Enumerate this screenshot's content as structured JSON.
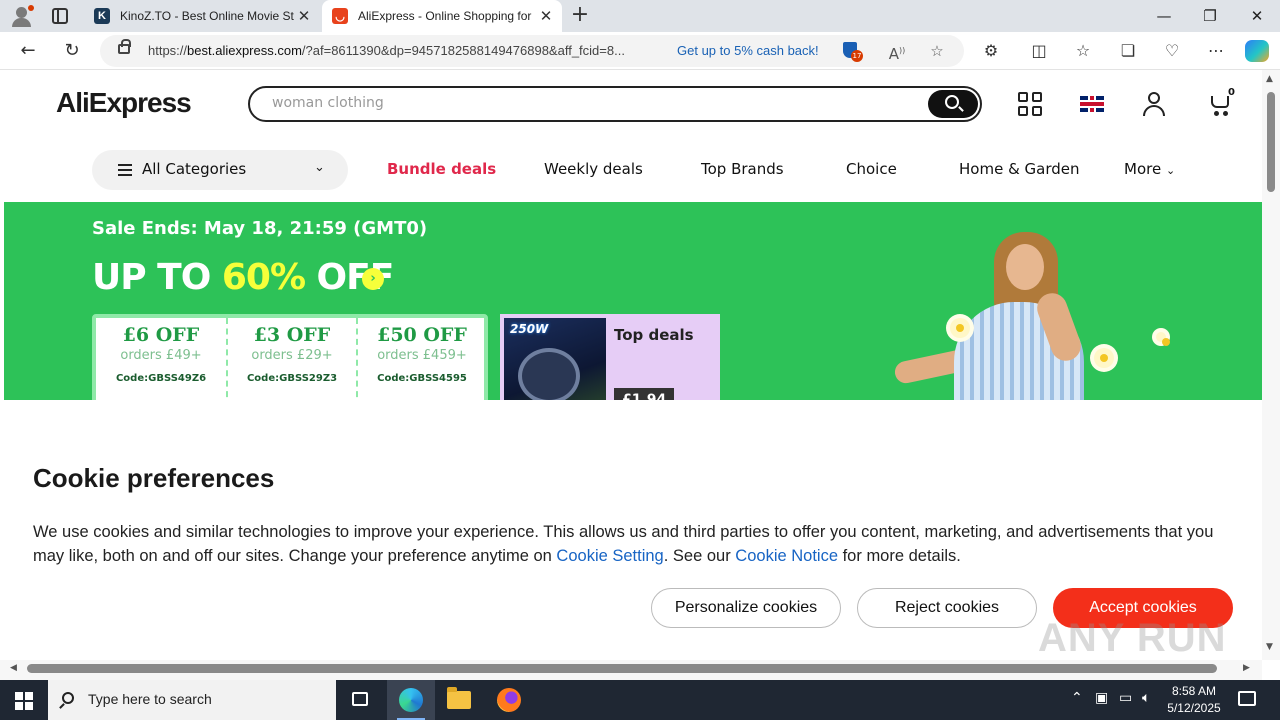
{
  "browser": {
    "tabs": [
      {
        "title": "KinoZ.TO - Best Online Movie Str",
        "favicon": "K"
      },
      {
        "title": "AliExpress - Online Shopping for",
        "favicon": "ali-bag"
      }
    ],
    "url_prefix": "https://",
    "url_host": "best.aliexpress.com",
    "url_rest": "/?af=8611390&dp=9457182588149476898&aff_fcid=8...",
    "cashback": "Get up to 5% cash back!",
    "ext_badge_count": "17"
  },
  "site": {
    "logo": "AliExpress",
    "search_placeholder": "woman clothing",
    "cart_count": "0",
    "categories_label": "All Categories",
    "nav": [
      "Bundle deals",
      "Weekly deals",
      "Top Brands",
      "Choice",
      "Home & Garden",
      "More"
    ],
    "accent_red": "#e0284b",
    "banner_green": "#2dc258"
  },
  "banner": {
    "sale_ends": "Sale Ends: May 18, 21:59 (GMT0)",
    "upto_prefix": "UP TO ",
    "upto_highlight": "60%",
    "upto_suffix": " OFF",
    "coupons": [
      {
        "off": "£6 OFF",
        "orders": "orders £49+",
        "code": "Code:GBSS49Z6"
      },
      {
        "off": "£3 OFF",
        "orders": "orders £29+",
        "code": "Code:GBSS29Z3"
      },
      {
        "off": "£50 OFF",
        "orders": "orders £459+",
        "code": "Code:GBSS4595"
      }
    ],
    "top_deals_label": "Top deals",
    "top_deals_badge": "250W",
    "top_deals_price": "£1.94"
  },
  "cookie": {
    "title": "Cookie preferences",
    "text_1": "We use cookies and similar technologies to improve your experience. This allows us and third parties to offer you content, marketing, and advertisements that you may like, both on and off our sites. Change your preference anytime on ",
    "link_setting": "Cookie Setting",
    "text_2": ". See our ",
    "link_notice": "Cookie Notice",
    "text_3": " for more details.",
    "btn_personalize": "Personalize cookies",
    "btn_reject": "Reject cookies",
    "btn_accept": "Accept cookies",
    "accept_color": "#f32f1a"
  },
  "watermark": "ANY RUN",
  "taskbar": {
    "search_placeholder": "Type here to search",
    "time": "8:58 AM",
    "date": "5/12/2025"
  }
}
